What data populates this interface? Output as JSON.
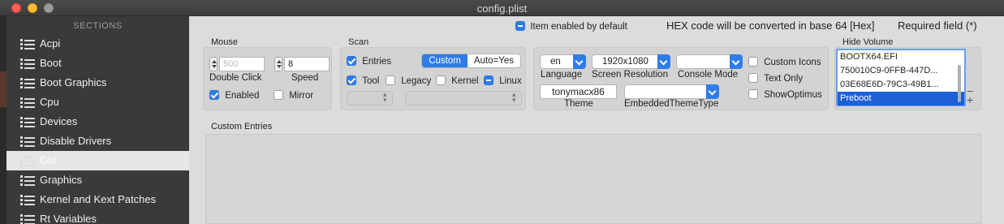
{
  "window": {
    "title": "config.plist"
  },
  "sidebar": {
    "header": "SECTIONS",
    "items": [
      {
        "label": "Acpi"
      },
      {
        "label": "Boot"
      },
      {
        "label": "Boot Graphics"
      },
      {
        "label": "Cpu"
      },
      {
        "label": "Devices"
      },
      {
        "label": "Disable Drivers"
      },
      {
        "label": "Gui",
        "selected": true
      },
      {
        "label": "Graphics"
      },
      {
        "label": "Kernel and Kext Patches"
      },
      {
        "label": "Rt Variables"
      }
    ]
  },
  "header": {
    "item_enabled_label": "Item enabled by default",
    "hex_note": "HEX code will be converted in base 64 [Hex]",
    "required_note": "Required field (*)"
  },
  "mouse": {
    "title": "Mouse",
    "double_click_value": "500",
    "double_click_label": "Double Click",
    "speed_value": "8",
    "speed_label": "Speed",
    "enabled_label": "Enabled",
    "enabled_checked": true,
    "mirror_label": "Mirror",
    "mirror_checked": false
  },
  "scan": {
    "title": "Scan",
    "entries_label": "Entries",
    "segment": [
      "Custom",
      "Auto=Yes"
    ],
    "tool_label": "Tool",
    "legacy_label": "Legacy",
    "kernel_label": "Kernel",
    "linux_label": "Linux"
  },
  "theme": {
    "language_value": "en",
    "language_label": "Language",
    "resolution_value": "1920x1080",
    "resolution_label": "Screen Resolution",
    "console_mode_value": "",
    "console_mode_label": "Console Mode",
    "custom_icons_label": "Custom Icons",
    "text_only_label": "Text Only",
    "show_optimus_label": "ShowOptimus",
    "theme_value": "tonymacx86",
    "theme_label": "Theme",
    "embedded_theme_label": "EmbeddedThemeType"
  },
  "hide_volume": {
    "title": "Hide Volume",
    "items": [
      "BOOTX64.EFI",
      "750010C9-0FFB-447D...",
      "03E68E6D-79C3-49B1...",
      "Preboot"
    ],
    "add_label": "+",
    "remove_label": "−"
  },
  "custom_entries": {
    "title": "Custom Entries"
  },
  "colors": {
    "accent": "#2f7ce8",
    "selection": "#1d5fd6"
  }
}
